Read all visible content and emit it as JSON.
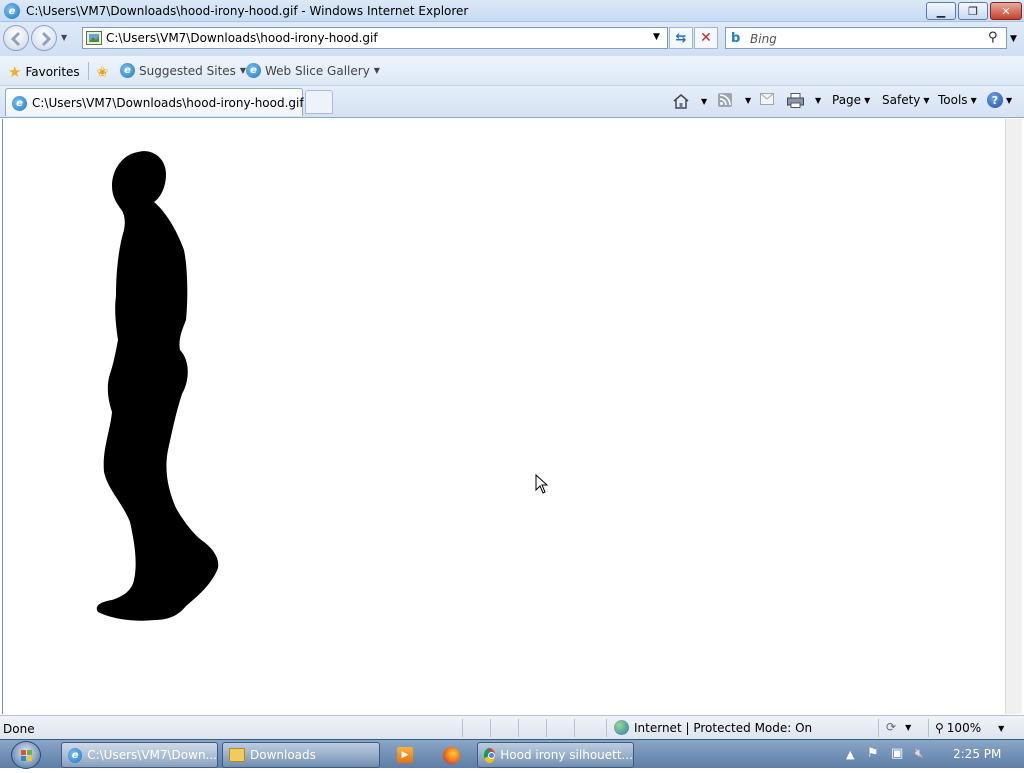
{
  "window": {
    "title": "C:\\Users\\VM7\\Downloads\\hood-irony-hood.gif - Windows Internet Explorer",
    "min": "▁",
    "max": "❐",
    "close": "✕"
  },
  "nav": {
    "address": "C:\\Users\\VM7\\Downloads\\hood-irony-hood.gif",
    "search_placeholder": "Bing",
    "refresh": "⇆",
    "stop": "✕"
  },
  "favorites": {
    "favorites_label": "Favorites",
    "suggested_label": "Suggested Sites",
    "webslice_label": "Web Slice Gallery"
  },
  "tabs": {
    "active_label": "C:\\Users\\VM7\\Downloads\\hood-irony-hood.gif"
  },
  "commands": {
    "page": "Page",
    "safety": "Safety",
    "tools": "Tools"
  },
  "status": {
    "text": "Done",
    "zone": "Internet | Protected Mode: On",
    "zoom": "100%"
  },
  "taskbar": {
    "ie_task": "C:\\Users\\VM7\\Down...",
    "downloads_task": "Downloads",
    "chrome_task": "Hood irony silhouett...",
    "clock": "2:25 PM"
  },
  "colors": {
    "silhouette": "#000000",
    "chrome_blue": "#cfdff3"
  }
}
